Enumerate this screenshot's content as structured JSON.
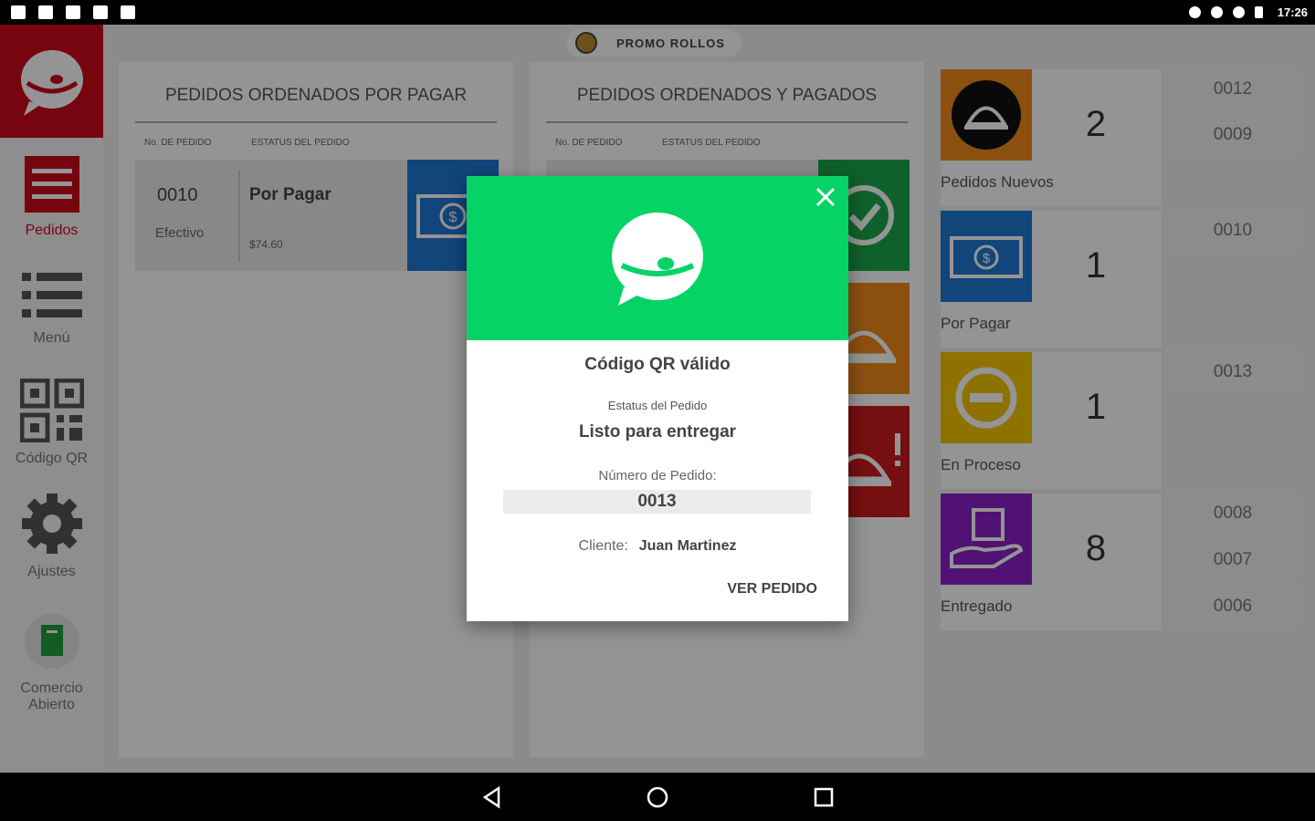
{
  "status_bar": {
    "time": "17:26"
  },
  "sidebar": {
    "items": [
      {
        "label": "Pedidos",
        "icon": "receipt-icon"
      },
      {
        "label": "Menú",
        "icon": "list-icon"
      },
      {
        "label": "Código QR",
        "icon": "qr-code-icon"
      },
      {
        "label": "Ajustes",
        "icon": "gear-icon"
      },
      {
        "label_line1": "Comercio",
        "label_line2": "Abierto",
        "icon": "store-open-icon"
      }
    ]
  },
  "header": {
    "store_name": "PROMO ROLLOS"
  },
  "columns": {
    "unpaid": {
      "title": "PEDIDOS ORDENADOS POR PAGAR",
      "col_order_no": "No. DE PEDIDO",
      "col_status": "ESTATUS DEL PEDIDO",
      "orders": [
        {
          "number": "0010",
          "method": "Efectivo",
          "status": "Por Pagar",
          "amount": "$74.60"
        }
      ]
    },
    "paid": {
      "title": "PEDIDOS ORDENADOS Y PAGADOS",
      "col_order_no": "No. DE PEDIDO",
      "col_status": "ESTATUS DEL PEDIDO"
    }
  },
  "dashboard": [
    {
      "label": "Pedidos Nuevos",
      "count": "2",
      "color": "#f08a1c",
      "icon": "cloche-icon",
      "orders": [
        "0012",
        "0009"
      ]
    },
    {
      "label": "Por Pagar",
      "count": "1",
      "color": "#1f78d1",
      "icon": "cash-icon",
      "orders": [
        "0010"
      ]
    },
    {
      "label": "En Proceso",
      "count": "1",
      "color": "#f5c400",
      "icon": "minus-circle-icon",
      "orders": [
        "0013"
      ]
    },
    {
      "label": "Entregado",
      "count": "8",
      "color": "#8a1fc8",
      "icon": "delivery-hand-icon",
      "orders": [
        "0008",
        "0007",
        "0006"
      ]
    }
  ],
  "dialog": {
    "title": "Código QR válido",
    "status_label": "Estatus del Pedido",
    "status_value": "Listo para entregar",
    "number_label": "Número de Pedido:",
    "number_value": "0013",
    "client_label": "Cliente:",
    "client_value": "Juan Martinez",
    "action_label": "VER PEDIDO",
    "header_color": "#06d365"
  },
  "colors": {
    "brand_red": "#cc0a1c",
    "green": "#1aa84a",
    "orange": "#f08a1c",
    "red": "#cc1a1a"
  }
}
